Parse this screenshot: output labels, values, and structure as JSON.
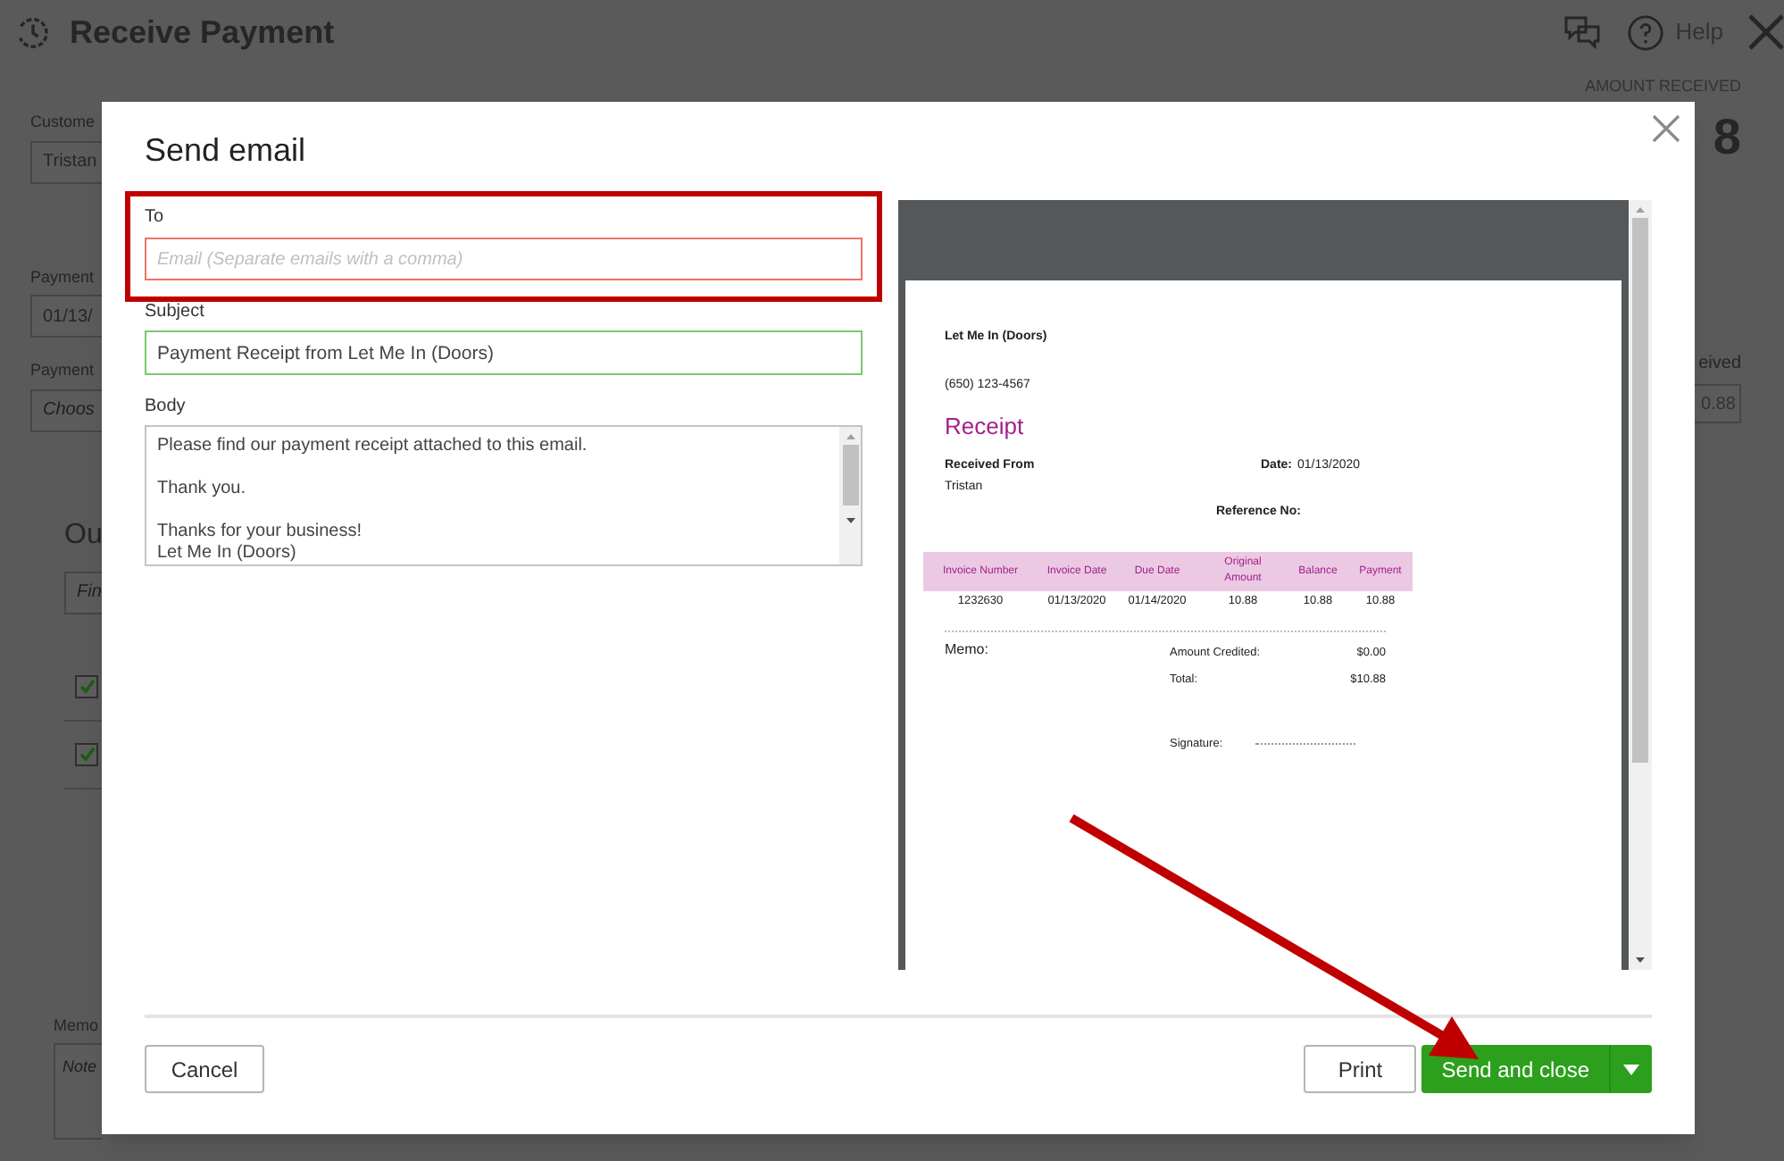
{
  "background": {
    "title": "Receive Payment",
    "help_label": "Help",
    "amount_label": "AMOUNT RECEIVED",
    "amount_value": "8",
    "customer_label": "Custome",
    "customer_value": "Tristan",
    "payment_date_label": "Payment",
    "payment_date_value": "01/13/",
    "payment_method_label": "Payment",
    "payment_method_placeholder": "Choos",
    "section_heading": "Ou",
    "find_placeholder": "Fin",
    "rows": [
      {
        "checked": true
      },
      {
        "checked": true
      }
    ],
    "memo_label": "Memo",
    "memo_placeholder": "Note",
    "received_label": "eived",
    "received_value": "0.88"
  },
  "dialog": {
    "title": "Send email",
    "to": {
      "label": "To",
      "placeholder": "Email (Separate emails with a comma)",
      "invalid": true,
      "highlighted": true
    },
    "subject": {
      "label": "Subject",
      "value": "Payment Receipt from Let Me In (Doors)"
    },
    "body": {
      "label": "Body",
      "value": "Please find our payment receipt attached to this email.\n\nThank you.\n\nThanks for your business!\nLet Me In (Doors)"
    },
    "preview": {
      "company": "Let Me In (Doors)",
      "phone": "(650) 123-4567",
      "title": "Receipt",
      "received_from_label": "Received From",
      "received_from": "Tristan",
      "date_label": "Date:",
      "date": "01/13/2020",
      "reference_label": "Reference No:",
      "columns": [
        "Invoice Number",
        "Invoice Date",
        "Due Date",
        "Original Amount",
        "Balance",
        "Payment"
      ],
      "rows": [
        [
          "1232630",
          "01/13/2020",
          "01/14/2020",
          "10.88",
          "10.88",
          "10.88"
        ]
      ],
      "memo_label": "Memo:",
      "amount_credited_label": "Amount Credited:",
      "amount_credited": "$0.00",
      "total_label": "Total:",
      "total": "$10.88",
      "signature_label": "Signature:"
    },
    "buttons": {
      "cancel": "Cancel",
      "print": "Print",
      "send": "Send and close",
      "send_pointed_at": true
    }
  }
}
